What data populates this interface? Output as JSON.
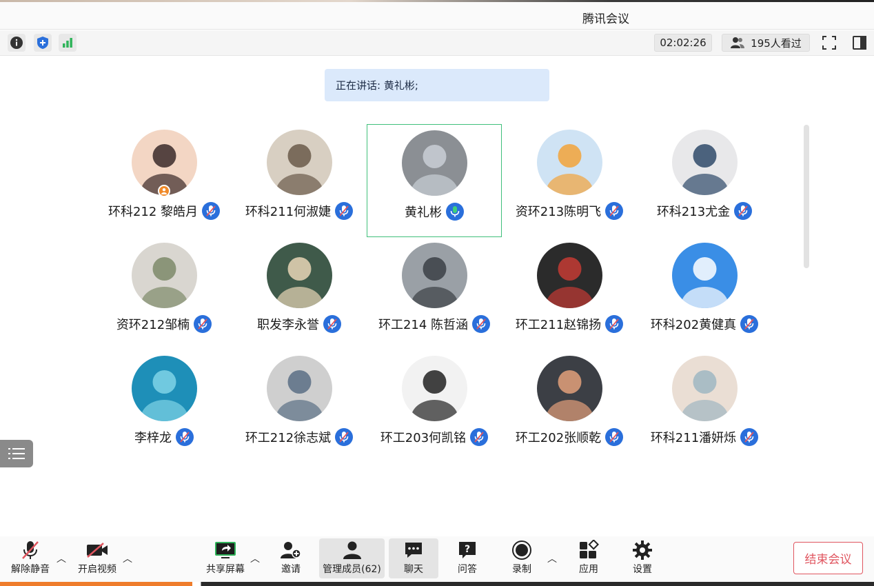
{
  "window": {
    "title": "腾讯会议"
  },
  "toolbar": {
    "timer": "02:02:26",
    "viewers": "195人看过",
    "icons": [
      "info-icon",
      "shield-icon",
      "signal-icon",
      "fullscreen-icon",
      "sidebar-toggle-icon"
    ],
    "colors": {
      "shield": "#2a6fdb",
      "signal": "#2fb45a"
    }
  },
  "speaking": {
    "text": "正在讲话: 黄礼彬;"
  },
  "participants": [
    {
      "name": "环科212 黎皓月",
      "mic": "muted",
      "host": true
    },
    {
      "name": "环科211何淑婕",
      "mic": "muted"
    },
    {
      "name": "黄礼彬",
      "mic": "live",
      "active": true
    },
    {
      "name": "资环213陈明飞",
      "mic": "muted"
    },
    {
      "name": "环科213尤金",
      "mic": "muted"
    },
    {
      "name": "资环212邹楠",
      "mic": "muted"
    },
    {
      "name": "职发李永誉",
      "mic": "muted"
    },
    {
      "name": "环工214 陈哲涵",
      "mic": "muted"
    },
    {
      "name": "环工211赵锦扬",
      "mic": "muted"
    },
    {
      "name": "环科202黄健真",
      "mic": "muted"
    },
    {
      "name": "李梓龙",
      "mic": "muted"
    },
    {
      "name": "环工212徐志斌",
      "mic": "muted"
    },
    {
      "name": "环工203何凯铭",
      "mic": "muted"
    },
    {
      "name": "环工202张顺乾",
      "mic": "muted"
    },
    {
      "name": "环科211潘妍烁",
      "mic": "muted"
    }
  ],
  "bottombar": {
    "unmute": "解除静音",
    "start_video": "开启视频",
    "share_screen": "共享屏幕",
    "invite": "邀请",
    "manage_members": "管理成员(62)",
    "chat": "聊天",
    "qa": "问答",
    "record": "录制",
    "apps": "应用",
    "settings": "设置",
    "end_meeting": "结束会议",
    "colors": {
      "end": "#e0555f",
      "share": "#2fb45a"
    }
  }
}
